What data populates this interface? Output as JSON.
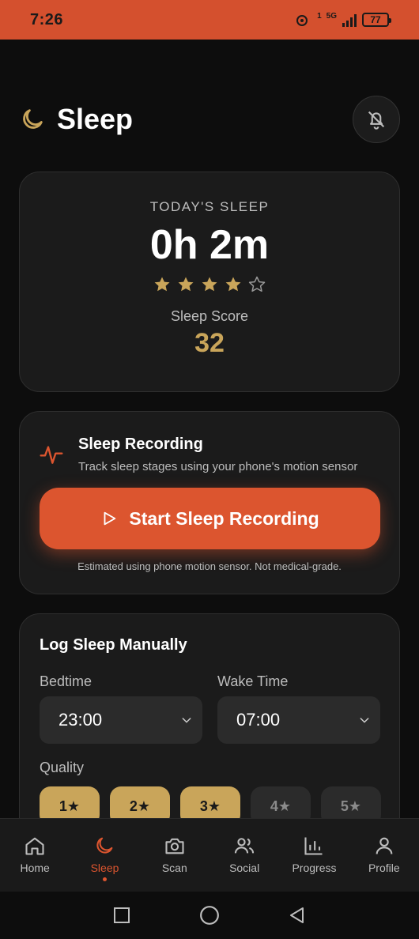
{
  "status_bar": {
    "time": "7:26",
    "network": "5G",
    "sim": "1",
    "battery": "77"
  },
  "header": {
    "title": "Sleep",
    "icon": "moon-icon",
    "bell_icon": "bell-off-icon"
  },
  "today": {
    "label": "TODAY'S SLEEP",
    "value": "0h 2m",
    "stars_filled": 4,
    "stars_total": 5,
    "score_label": "Sleep Score",
    "score_value": "32"
  },
  "recording": {
    "title": "Sleep Recording",
    "subtitle": "Track sleep stages using your phone's motion sensor",
    "button_label": "Start Sleep Recording",
    "note": "Estimated using phone motion sensor. Not medical-grade."
  },
  "manual_log": {
    "title": "Log Sleep Manually",
    "bedtime_label": "Bedtime",
    "bedtime_value": "23:00",
    "wake_label": "Wake Time",
    "wake_value": "07:00",
    "quality_label": "Quality",
    "quality_options": [
      "1★",
      "2★",
      "3★",
      "4★",
      "5★"
    ],
    "quality_selected": 3
  },
  "bottom_nav": {
    "items": [
      {
        "label": "Home",
        "icon": "home-icon"
      },
      {
        "label": "Sleep",
        "icon": "moon-icon"
      },
      {
        "label": "Scan",
        "icon": "camera-icon"
      },
      {
        "label": "Social",
        "icon": "users-icon"
      },
      {
        "label": "Progress",
        "icon": "bar-chart-icon"
      },
      {
        "label": "Profile",
        "icon": "user-icon"
      }
    ],
    "active": "Sleep"
  },
  "colors": {
    "accent": "#dc552f",
    "gold": "#c9a55a",
    "background": "#0d0d0d",
    "card": "#1b1b1b"
  }
}
